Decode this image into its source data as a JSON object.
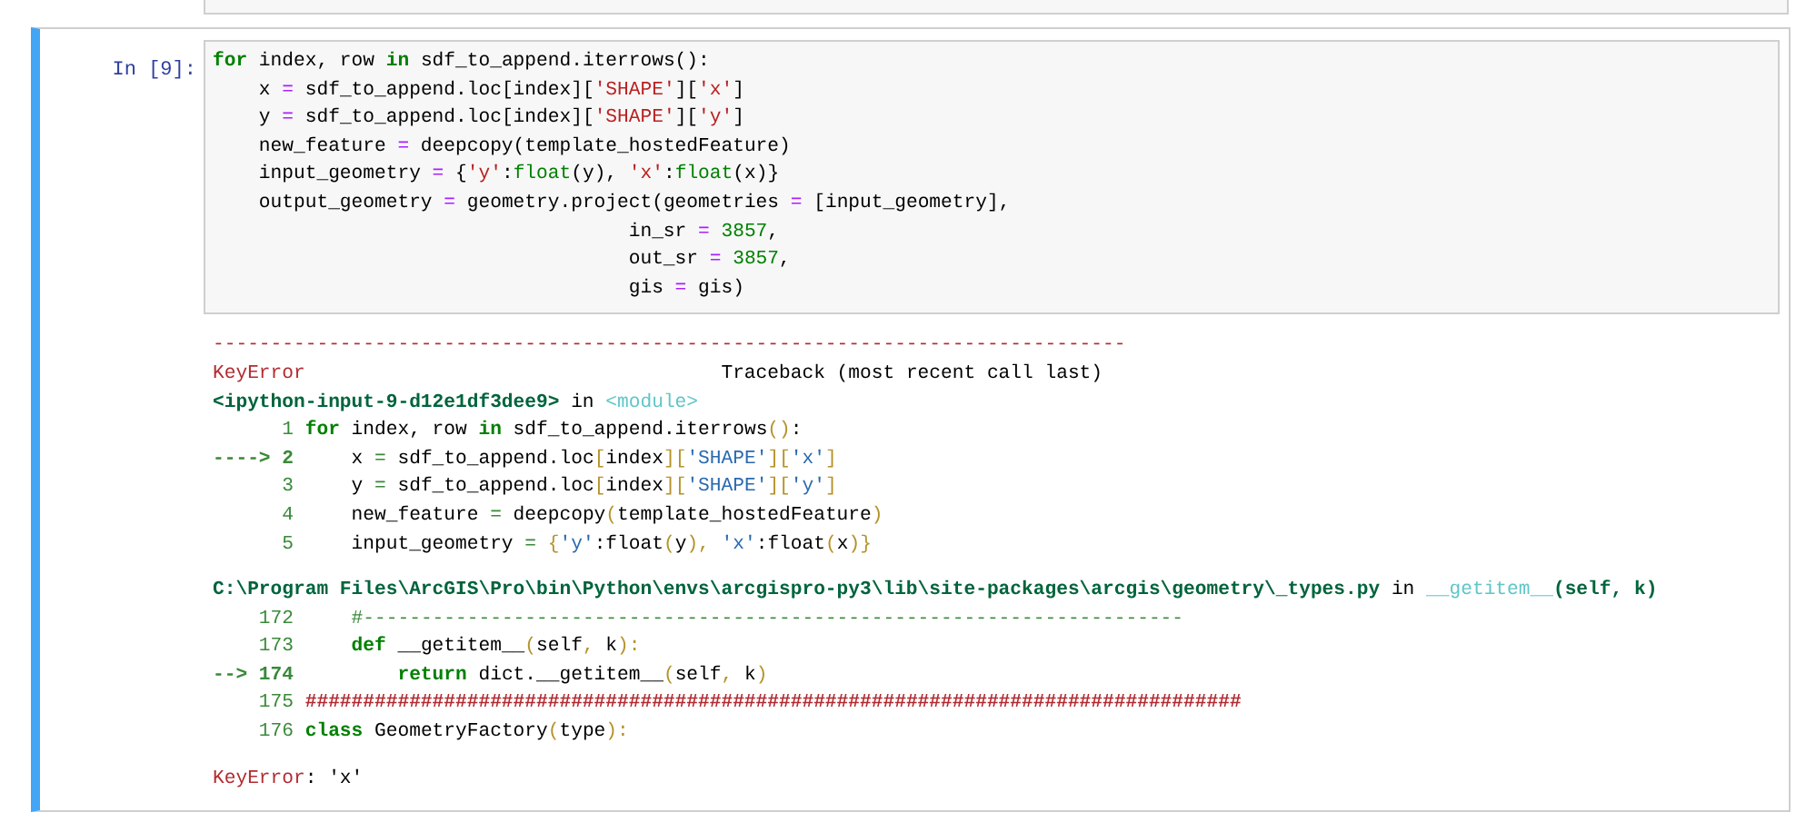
{
  "cell": {
    "prompt": "In [9]:",
    "selected": true,
    "input_lines": [
      [
        {
          "text": "for",
          "kind": "kw"
        },
        {
          "text": " index, row ",
          "kind": "plain"
        },
        {
          "text": "in",
          "kind": "kw"
        },
        {
          "text": " sdf_to_append.iterrows():",
          "kind": "plain"
        }
      ],
      [
        {
          "text": "    x ",
          "kind": "plain"
        },
        {
          "text": "=",
          "kind": "op"
        },
        {
          "text": " sdf_to_append.loc[index][",
          "kind": "plain"
        },
        {
          "text": "'SHAPE'",
          "kind": "str"
        },
        {
          "text": "][",
          "kind": "plain"
        },
        {
          "text": "'x'",
          "kind": "str"
        },
        {
          "text": "]",
          "kind": "plain"
        }
      ],
      [
        {
          "text": "    y ",
          "kind": "plain"
        },
        {
          "text": "=",
          "kind": "op"
        },
        {
          "text": " sdf_to_append.loc[index][",
          "kind": "plain"
        },
        {
          "text": "'SHAPE'",
          "kind": "str"
        },
        {
          "text": "][",
          "kind": "plain"
        },
        {
          "text": "'y'",
          "kind": "str"
        },
        {
          "text": "]",
          "kind": "plain"
        }
      ],
      [
        {
          "text": "    new_feature ",
          "kind": "plain"
        },
        {
          "text": "=",
          "kind": "op"
        },
        {
          "text": " deepcopy(template_hostedFeature)",
          "kind": "plain"
        }
      ],
      [
        {
          "text": "    input_geometry ",
          "kind": "plain"
        },
        {
          "text": "=",
          "kind": "op"
        },
        {
          "text": " {",
          "kind": "plain"
        },
        {
          "text": "'y'",
          "kind": "str"
        },
        {
          "text": ":",
          "kind": "plain"
        },
        {
          "text": "float",
          "kind": "builtin"
        },
        {
          "text": "(y), ",
          "kind": "plain"
        },
        {
          "text": "'x'",
          "kind": "str"
        },
        {
          "text": ":",
          "kind": "plain"
        },
        {
          "text": "float",
          "kind": "builtin"
        },
        {
          "text": "(x)}",
          "kind": "plain"
        }
      ],
      [
        {
          "text": "    output_geometry ",
          "kind": "plain"
        },
        {
          "text": "=",
          "kind": "op"
        },
        {
          "text": " geometry.project(geometries ",
          "kind": "plain"
        },
        {
          "text": "=",
          "kind": "op"
        },
        {
          "text": " [input_geometry],",
          "kind": "plain"
        }
      ],
      [
        {
          "text": "                                    in_sr ",
          "kind": "plain"
        },
        {
          "text": "=",
          "kind": "op"
        },
        {
          "text": " 3857",
          "kind": "num"
        },
        {
          "text": ",",
          "kind": "plain"
        }
      ],
      [
        {
          "text": "                                    out_sr ",
          "kind": "plain"
        },
        {
          "text": "=",
          "kind": "op"
        },
        {
          "text": " 3857",
          "kind": "num"
        },
        {
          "text": ",",
          "kind": "plain"
        }
      ],
      [
        {
          "text": "                                    gis ",
          "kind": "plain"
        },
        {
          "text": "=",
          "kind": "op"
        },
        {
          "text": " gis)",
          "kind": "plain"
        }
      ]
    ],
    "output_blocks": [
      [
        [
          {
            "text": "-------------------------------------------------------------------------------",
            "kind": "err"
          }
        ],
        [
          {
            "text": "KeyError",
            "kind": "err"
          },
          {
            "text": "                                    Traceback (most recent call last)",
            "kind": "plain"
          }
        ],
        [
          {
            "text": "<ipython-input-9-d12e1df3dee9>",
            "kind": "path"
          },
          {
            "text": " in ",
            "kind": "plain"
          },
          {
            "text": "<module>",
            "kind": "func"
          }
        ],
        [
          {
            "text": "      1 ",
            "kind": "lineno"
          },
          {
            "text": "for",
            "kind": "kw"
          },
          {
            "text": " index, row ",
            "kind": "plain"
          },
          {
            "text": "in",
            "kind": "kw"
          },
          {
            "text": " sdf_to_append.iterrows",
            "kind": "plain"
          },
          {
            "text": "()",
            "kind": "paren"
          },
          {
            "text": ":",
            "kind": "plain"
          }
        ],
        [
          {
            "text": "----> 2 ",
            "kind": "arrow"
          },
          {
            "text": "    x ",
            "kind": "plain"
          },
          {
            "text": "=",
            "kind": "lineno"
          },
          {
            "text": " sdf_to_append.loc",
            "kind": "plain"
          },
          {
            "text": "[",
            "kind": "paren"
          },
          {
            "text": "index",
            "kind": "plain"
          },
          {
            "text": "][",
            "kind": "paren"
          },
          {
            "text": "'SHAPE'",
            "kind": "blue"
          },
          {
            "text": "][",
            "kind": "paren"
          },
          {
            "text": "'x'",
            "kind": "blue"
          },
          {
            "text": "]",
            "kind": "paren"
          }
        ],
        [
          {
            "text": "      3 ",
            "kind": "lineno"
          },
          {
            "text": "    y ",
            "kind": "plain"
          },
          {
            "text": "=",
            "kind": "lineno"
          },
          {
            "text": " sdf_to_append.loc",
            "kind": "plain"
          },
          {
            "text": "[",
            "kind": "paren"
          },
          {
            "text": "index",
            "kind": "plain"
          },
          {
            "text": "][",
            "kind": "paren"
          },
          {
            "text": "'SHAPE'",
            "kind": "blue"
          },
          {
            "text": "][",
            "kind": "paren"
          },
          {
            "text": "'y'",
            "kind": "blue"
          },
          {
            "text": "]",
            "kind": "paren"
          }
        ],
        [
          {
            "text": "      4 ",
            "kind": "lineno"
          },
          {
            "text": "    new_feature ",
            "kind": "plain"
          },
          {
            "text": "=",
            "kind": "lineno"
          },
          {
            "text": " deepcopy",
            "kind": "plain"
          },
          {
            "text": "(",
            "kind": "paren"
          },
          {
            "text": "template_hostedFeature",
            "kind": "plain"
          },
          {
            "text": ")",
            "kind": "paren"
          }
        ],
        [
          {
            "text": "      5 ",
            "kind": "lineno"
          },
          {
            "text": "    input_geometry ",
            "kind": "plain"
          },
          {
            "text": "=",
            "kind": "lineno"
          },
          {
            "text": " {",
            "kind": "paren"
          },
          {
            "text": "'y'",
            "kind": "blue"
          },
          {
            "text": ":float",
            "kind": "plain"
          },
          {
            "text": "(",
            "kind": "paren"
          },
          {
            "text": "y",
            "kind": "plain"
          },
          {
            "text": "), ",
            "kind": "paren"
          },
          {
            "text": "'x'",
            "kind": "blue"
          },
          {
            "text": ":float",
            "kind": "plain"
          },
          {
            "text": "(",
            "kind": "paren"
          },
          {
            "text": "x",
            "kind": "plain"
          },
          {
            "text": ")}",
            "kind": "paren"
          }
        ]
      ],
      [
        [
          {
            "text": "C:\\Program Files\\ArcGIS\\Pro\\bin\\Python\\envs\\arcgispro-py3\\lib\\site-packages\\arcgis\\geometry\\_types.py",
            "kind": "path"
          },
          {
            "text": " in ",
            "kind": "plain"
          },
          {
            "text": "__getitem__",
            "kind": "func"
          },
          {
            "text": "(self, k)",
            "kind": "path"
          }
        ],
        [
          {
            "text": "    172     ",
            "kind": "lineno"
          },
          {
            "text": "#-----------------------------------------------------------------------",
            "kind": "lineno"
          }
        ],
        [
          {
            "text": "    173     ",
            "kind": "lineno"
          },
          {
            "text": "def",
            "kind": "kw"
          },
          {
            "text": " __getitem__",
            "kind": "plain"
          },
          {
            "text": "(",
            "kind": "paren"
          },
          {
            "text": "self",
            "kind": "plain"
          },
          {
            "text": ",",
            "kind": "paren"
          },
          {
            "text": " k",
            "kind": "plain"
          },
          {
            "text": "):",
            "kind": "paren"
          }
        ],
        [
          {
            "text": "--> 174         ",
            "kind": "arrow"
          },
          {
            "text": "return",
            "kind": "kw"
          },
          {
            "text": " dict.__getitem__",
            "kind": "plain"
          },
          {
            "text": "(",
            "kind": "paren"
          },
          {
            "text": "self",
            "kind": "plain"
          },
          {
            "text": ",",
            "kind": "paren"
          },
          {
            "text": " k",
            "kind": "plain"
          },
          {
            "text": ")",
            "kind": "paren"
          }
        ],
        [
          {
            "text": "    175 ",
            "kind": "lineno"
          },
          {
            "text": "#################################################################################",
            "kind": "hash"
          }
        ],
        [
          {
            "text": "    176 ",
            "kind": "lineno"
          },
          {
            "text": "class",
            "kind": "kw"
          },
          {
            "text": " GeometryFactory",
            "kind": "plain"
          },
          {
            "text": "(",
            "kind": "paren"
          },
          {
            "text": "type",
            "kind": "plain"
          },
          {
            "text": "):",
            "kind": "paren"
          }
        ]
      ],
      [
        [
          {
            "text": "KeyError",
            "kind": "err"
          },
          {
            "text": ": 'x'",
            "kind": "plain"
          }
        ]
      ]
    ]
  }
}
